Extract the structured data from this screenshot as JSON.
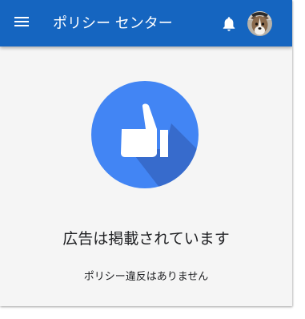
{
  "header": {
    "title": "ポリシー センター",
    "menu_icon": "menu-icon",
    "notification_icon": "bell-icon",
    "avatar_icon": "avatar-dog"
  },
  "status": {
    "icon": "thumbs-up-icon",
    "headline": "広告は掲載されています",
    "detail": "ポリシー違反はありません"
  },
  "colors": {
    "header_bg": "#1565c0",
    "accent_circle": "#4285f4",
    "background": "#f5f5f5"
  }
}
